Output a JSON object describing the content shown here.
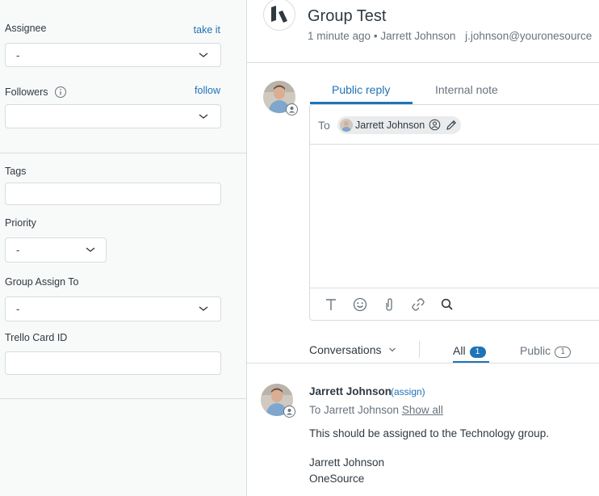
{
  "sidebar": {
    "assignee": {
      "label": "Assignee",
      "action": "take it",
      "value": "-"
    },
    "followers": {
      "label": "Followers",
      "action": "follow",
      "value": ""
    },
    "tags": {
      "label": "Tags",
      "value": ""
    },
    "priority": {
      "label": "Priority",
      "value": "-"
    },
    "group_assign": {
      "label": "Group Assign To",
      "value": "-"
    },
    "trello": {
      "label": "Trello Card ID",
      "value": ""
    }
  },
  "ticket": {
    "title": "Group Test",
    "time": "1 minute ago",
    "separator": "•",
    "requester": "Jarrett Johnson",
    "email": "j.johnson@youronesource"
  },
  "composer": {
    "tab_public": "Public reply",
    "tab_internal": "Internal note",
    "to_label": "To",
    "recipient": "Jarrett Johnson"
  },
  "conversations": {
    "filter_label": "Conversations",
    "tab_all": "All",
    "all_count": "1",
    "tab_public": "Public",
    "public_count": "1"
  },
  "message": {
    "author": "Jarrett Johnson",
    "assign": "(assign)",
    "to_prefix": "To Jarrett Johnson",
    "show_all": "Show all",
    "body": "This should be assigned to the Technology group.",
    "sig_name": "Jarrett Johnson",
    "sig_company": "OneSource"
  },
  "colors": {
    "accent": "#1f73b7",
    "border": "#d8dcde",
    "muted": "#68737d",
    "sidebar_bg": "#f8f9f9"
  }
}
